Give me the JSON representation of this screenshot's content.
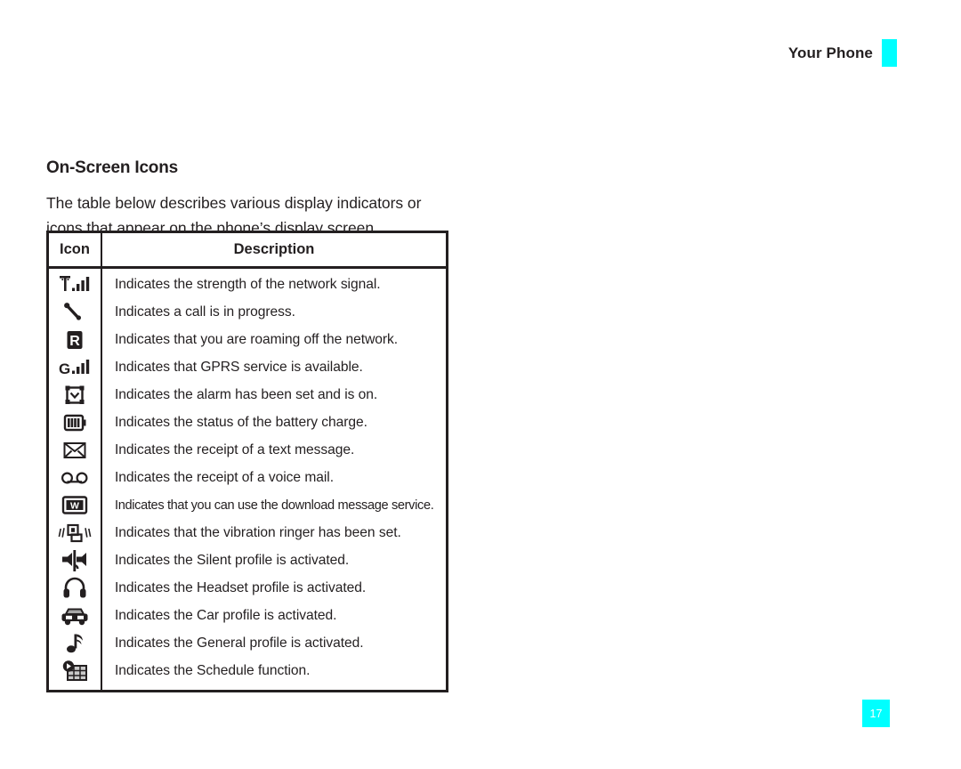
{
  "header": {
    "title": "Your Phone",
    "tab_color": "#00ffff"
  },
  "section": {
    "title": "On-Screen Icons",
    "intro": "The table below describes various display indicators or icons that appear on the phone’s display screen."
  },
  "table": {
    "columns": [
      "Icon",
      "Description"
    ],
    "rows": [
      {
        "icon": "signal-strength-icon",
        "description": "Indicates the strength of the network signal."
      },
      {
        "icon": "call-in-progress-icon",
        "description": "Indicates a call is in progress."
      },
      {
        "icon": "roaming-icon",
        "description": "Indicates that you are roaming off the network."
      },
      {
        "icon": "gprs-service-icon",
        "description": "Indicates that GPRS service is available."
      },
      {
        "icon": "alarm-clock-icon",
        "description": "Indicates the alarm has been set and is on."
      },
      {
        "icon": "battery-icon",
        "description": "Indicates the status of the battery charge."
      },
      {
        "icon": "text-message-icon",
        "description": "Indicates the receipt of a text message."
      },
      {
        "icon": "voice-mail-icon",
        "description": "Indicates the receipt of a voice mail."
      },
      {
        "icon": "download-message-icon",
        "description": "Indicates that you can use the download message service.",
        "condensed": true
      },
      {
        "icon": "vibration-ringer-icon",
        "description": "Indicates that the vibration ringer has been set."
      },
      {
        "icon": "silent-profile-icon",
        "description": "Indicates the Silent profile is activated."
      },
      {
        "icon": "headset-profile-icon",
        "description": "Indicates the Headset profile is activated."
      },
      {
        "icon": "car-profile-icon",
        "description": "Indicates the Car profile is activated."
      },
      {
        "icon": "general-profile-icon",
        "description": "Indicates the General profile is activated."
      },
      {
        "icon": "schedule-function-icon",
        "description": "Indicates the Schedule function."
      }
    ]
  },
  "footer": {
    "page_number": "17",
    "badge_color": "#00ffff"
  }
}
